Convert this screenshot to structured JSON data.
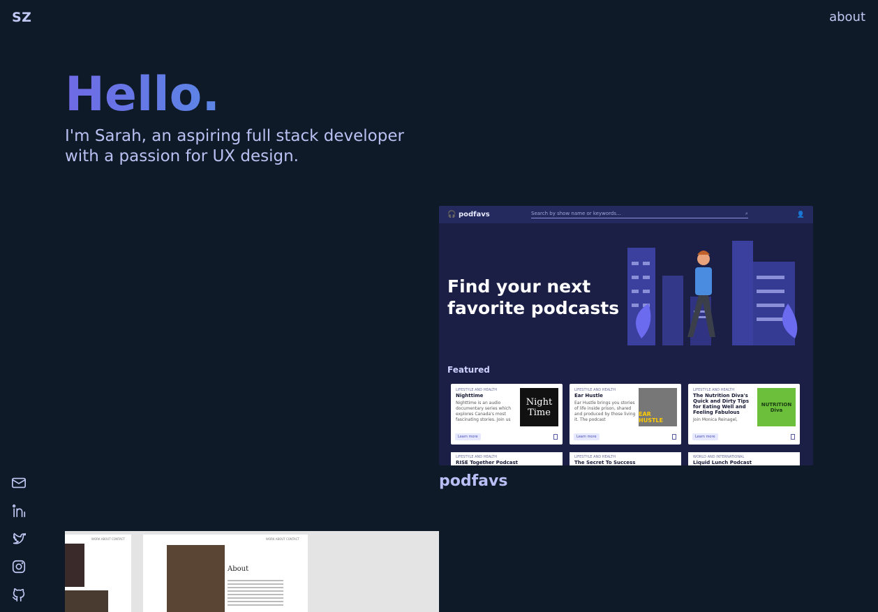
{
  "header": {
    "logo": "SZ",
    "nav_about": "about"
  },
  "hero": {
    "title": "Hello.",
    "subtitle": "I'm Sarah, an aspiring full stack developer with a passion for UX design."
  },
  "social": [
    {
      "icon": "mail-icon"
    },
    {
      "icon": "linkedin-icon"
    },
    {
      "icon": "twitter-icon"
    },
    {
      "icon": "instagram-icon"
    },
    {
      "icon": "github-icon"
    }
  ],
  "project": {
    "title": "podfavs",
    "preview": {
      "brand": "podfavs",
      "search_placeholder": "Search by show name or keywords...",
      "hero_text": "Find your next favorite podcasts",
      "featured_label": "Featured",
      "cards": [
        {
          "category": "LIFESTYLE AND HEALTH",
          "name": "Nighttime",
          "desc": "Nighttime is an audio documentary series which explores Canada's most fascinating stories. Join us",
          "thumb_text": "Night Time",
          "learn": "Learn more"
        },
        {
          "category": "LIFESTYLE AND HEALTH",
          "name": "Ear Hustle",
          "desc": "Ear Hustle brings you stories of life inside prison, shared and produced by those living it. The podcast",
          "thumb_text": "EAR HUSTLE",
          "learn": "Learn more"
        },
        {
          "category": "LIFESTYLE AND HEALTH",
          "name": "The Nutrition Diva's Quick and Dirty Tips for Eating Well and Feeling Fabulous",
          "desc": "Join Monica Reinagel,",
          "thumb_text": "NUTRITION Diva",
          "learn": "Learn more"
        }
      ],
      "cards_row2": [
        {
          "category": "LIFESTYLE AND HEALTH",
          "name": "RISE Together Podcast"
        },
        {
          "category": "LIFESTYLE AND HEALTH",
          "name": "The Secret To Success"
        },
        {
          "category": "WORLD AND INTERNATIONAL",
          "name": "Liquid Lunch Podcast"
        }
      ]
    }
  },
  "project2": {
    "nav": "WORK  ABOUT  CONTACT",
    "heading": "About"
  }
}
